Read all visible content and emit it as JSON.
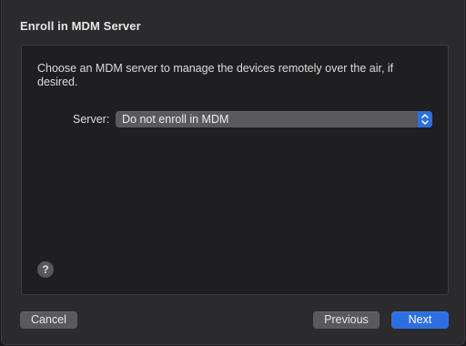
{
  "dialog": {
    "title": "Enroll in MDM Server",
    "description": "Choose an MDM server to manage the devices remotely over the air, if desired.",
    "server_label": "Server:",
    "server_value": "Do not enroll in MDM",
    "help_glyph": "?"
  },
  "buttons": {
    "cancel": "Cancel",
    "previous": "Previous",
    "next": "Next"
  },
  "colors": {
    "accent": "#2d6fe0",
    "background": "#2b2a2d",
    "panel": "#1f1e21"
  },
  "icons": {
    "popup_stepper": "up-down-chevron-icon",
    "help": "help-icon"
  }
}
